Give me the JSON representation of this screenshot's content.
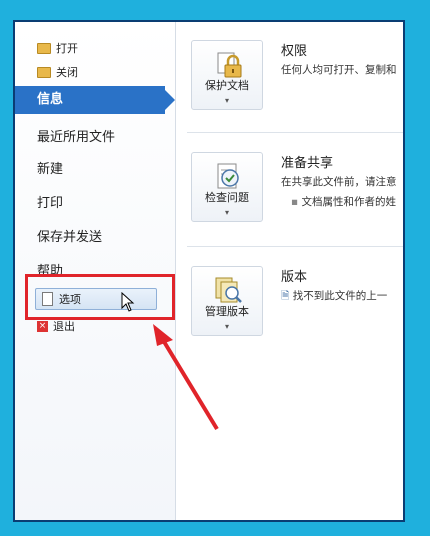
{
  "sidebar": {
    "open_label": "打开",
    "close_label": "关闭",
    "selected_label": "信息",
    "recent_label": "最近所用文件",
    "new_label": "新建",
    "print_label": "打印",
    "save_send_label": "保存并发送",
    "help_label": "帮助",
    "options_label": "选项",
    "exit_label": "退出"
  },
  "sections": {
    "permissions": {
      "button_label": "保护文档",
      "title": "权限",
      "desc": "任何人均可打开、复制和"
    },
    "prepare": {
      "button_label": "检查问题",
      "title": "准备共享",
      "desc1": "在共享此文件前，请注意",
      "desc2": "文档属性和作者的姓"
    },
    "versions": {
      "button_label": "管理版本",
      "title": "版本",
      "desc": "找不到此文件的上一"
    }
  },
  "icons": [
    "folder-open-icon",
    "folder-icon",
    "options-doc-icon",
    "exit-icon",
    "lock-icon",
    "inspect-icon",
    "versions-icon",
    "cursor-icon"
  ],
  "colors": {
    "selected": "#2a72c7",
    "highlight": "#e0242a",
    "background": "#1fb0dd"
  }
}
